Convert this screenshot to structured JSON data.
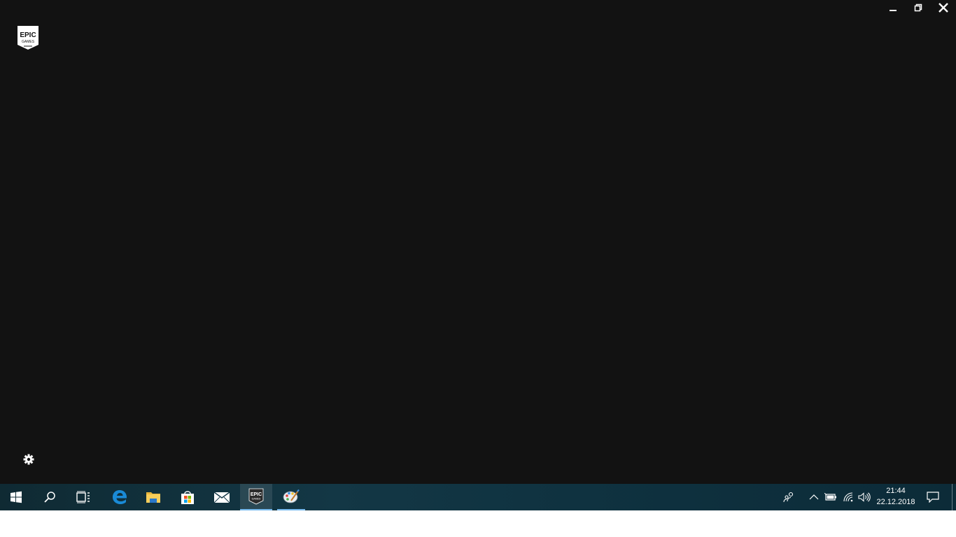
{
  "app": {
    "logo_text_top": "EPIC",
    "logo_text_bottom": "GAMES",
    "window_controls": {
      "minimize": "minimize-icon",
      "restore": "restore-icon",
      "close": "close-icon"
    },
    "settings_icon": "gear-icon"
  },
  "taskbar": {
    "items": [
      {
        "name": "start",
        "icon": "windows-logo-icon"
      },
      {
        "name": "search",
        "icon": "search-icon"
      },
      {
        "name": "task-view",
        "icon": "task-view-icon"
      },
      {
        "name": "edge",
        "icon": "edge-icon"
      },
      {
        "name": "file-explorer",
        "icon": "folder-icon"
      },
      {
        "name": "store",
        "icon": "store-icon"
      },
      {
        "name": "mail",
        "icon": "mail-icon"
      },
      {
        "name": "epic-games",
        "icon": "epic-games-icon",
        "state": "active"
      },
      {
        "name": "paint",
        "icon": "paint-icon",
        "state": "running"
      }
    ],
    "tray": {
      "people_icon": "people-icon",
      "chevron_icon": "chevron-up-icon",
      "battery_icon": "battery-icon",
      "network_icon": "wifi-icon",
      "volume_icon": "volume-icon",
      "notification_icon": "action-center-icon"
    },
    "clock": {
      "time": "21:44",
      "date": "22.12.2018"
    }
  },
  "colors": {
    "app_bg": "#121212",
    "taskbar_bg": "#133745",
    "accent": "#76b9ed"
  }
}
